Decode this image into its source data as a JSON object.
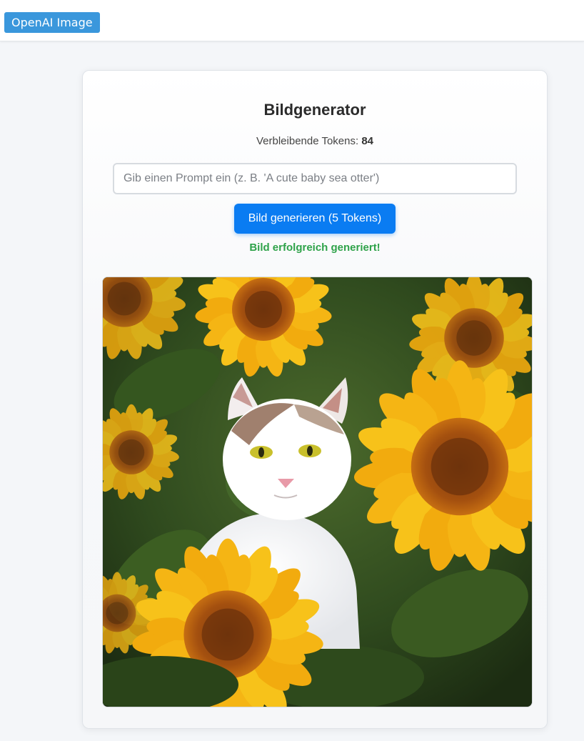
{
  "header": {
    "brand_label": "OpenAI Image"
  },
  "main": {
    "title": "Bildgenerator",
    "tokens_label": "Verbleibende Tokens:",
    "tokens_value": "84",
    "prompt_placeholder": "Gib einen Prompt ein (z. B. 'A cute baby sea otter')",
    "prompt_value": "",
    "generate_button_label": "Bild generieren (5 Tokens)",
    "status_message": "Bild erfolgreich generiert!"
  },
  "colors": {
    "brand": "#3a97dc",
    "primary_button": "#0a7cf2",
    "success": "#2fa24a"
  }
}
